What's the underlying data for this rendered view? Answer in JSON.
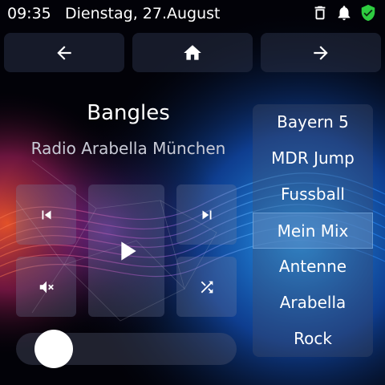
{
  "status": {
    "time": "09:35",
    "date": "Dienstag, 27.August",
    "icons": [
      "trash-icon",
      "bell-icon",
      "shield-check-icon"
    ],
    "shield_color": "#2ecc40"
  },
  "nav": {
    "back_icon": "arrow-left-icon",
    "home_icon": "home-icon",
    "forward_icon": "arrow-right-icon"
  },
  "now_playing": {
    "artist": "Bangles",
    "station": "Radio Arabella München"
  },
  "controls": {
    "previous_icon": "skip-previous-icon",
    "play_icon": "play-icon",
    "next_icon": "skip-next-icon",
    "mute_icon": "volume-mute-icon",
    "shuffle_icon": "shuffle-icon"
  },
  "volume": {
    "level": 0.1
  },
  "playlist": {
    "items": [
      "Bayern 5",
      "MDR Jump",
      "Fussball",
      "Mein Mix",
      "Antenne",
      "Arabella",
      "Rock"
    ],
    "selected": "Mein Mix"
  }
}
